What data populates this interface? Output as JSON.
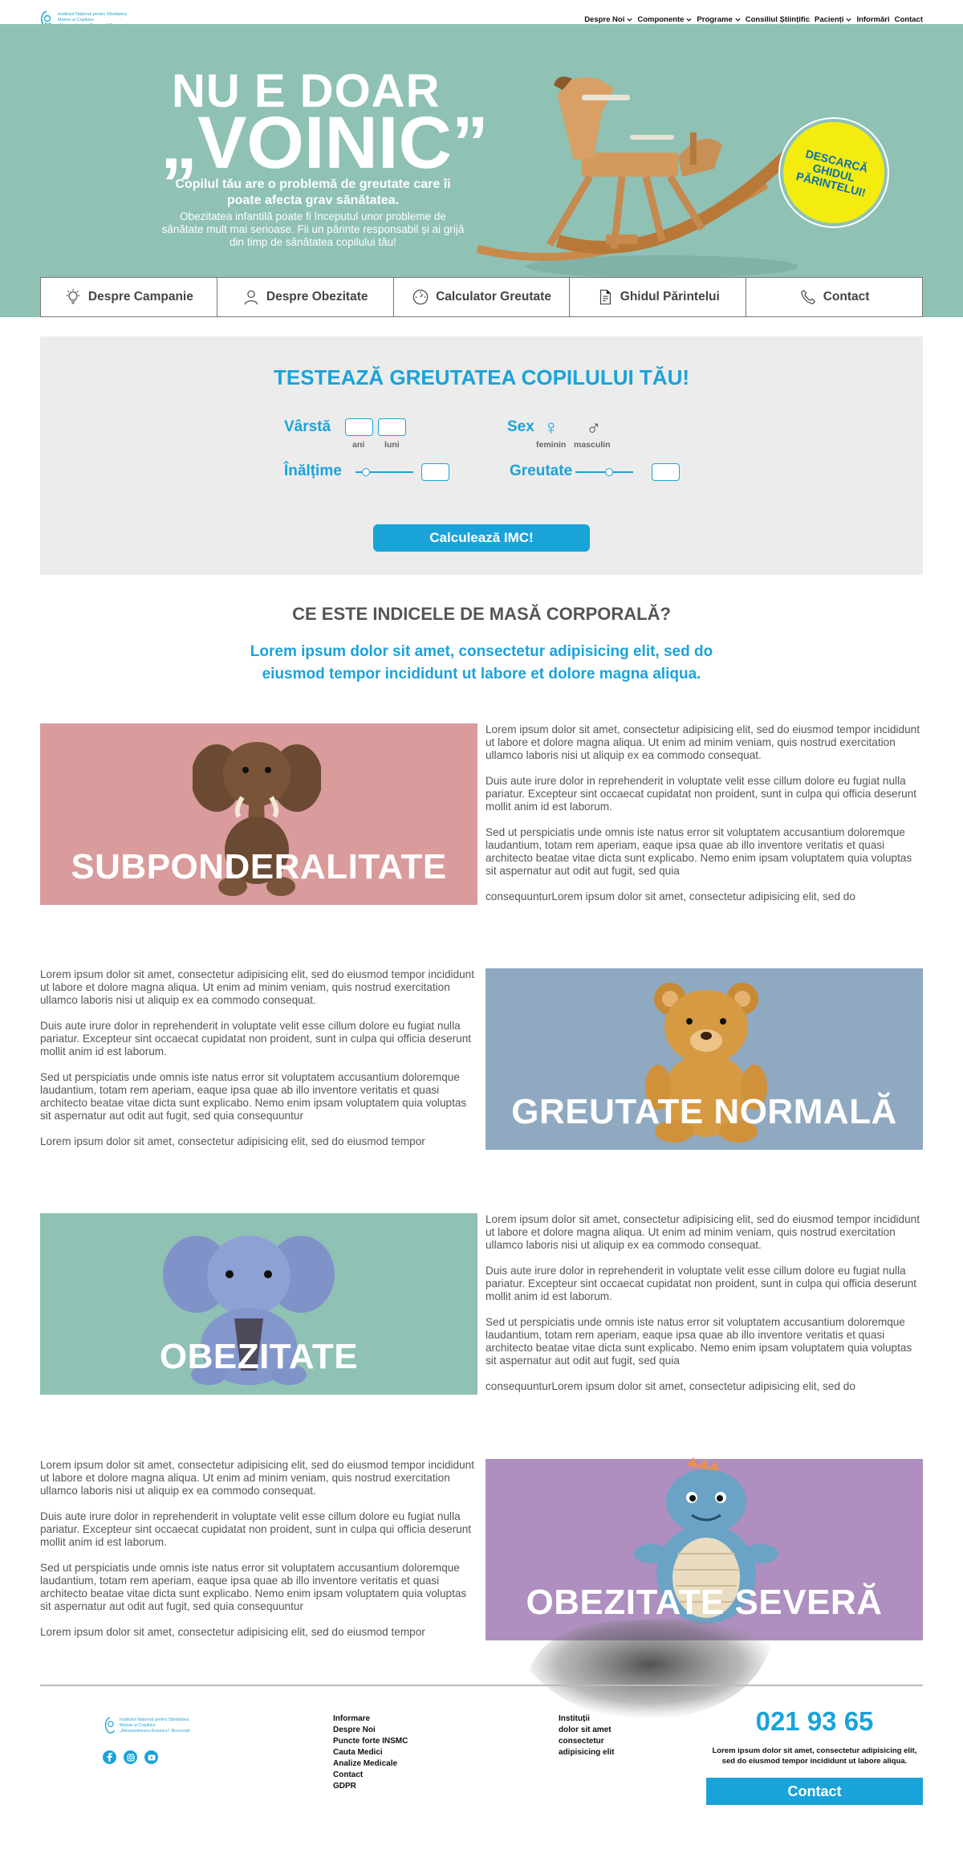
{
  "logo": {
    "lines": [
      "Institutul Național pentru Sănătatea",
      "Mamei și Copilului",
      "„Alessandrescu-Rusescu\" București"
    ]
  },
  "nav": {
    "items": [
      {
        "label": "Despre Noi",
        "dropdown": true
      },
      {
        "label": "Componente",
        "dropdown": true
      },
      {
        "label": "Programe",
        "dropdown": true
      },
      {
        "label": "Consiliul Științific",
        "dropdown": false
      },
      {
        "label": "Pacienți",
        "dropdown": true
      },
      {
        "label": "Informări",
        "dropdown": false
      },
      {
        "label": "Contact",
        "dropdown": false
      }
    ]
  },
  "hero": {
    "title_line1": "NU E DOAR",
    "title_line2": "„VOINIC”",
    "subtitle": "Copilul tău are o problemă de greutate care îi poate afecta grav sănătatea.",
    "description": "Obezitatea infantilă poate fi începutul unor probleme de sănătate mult mai serioase. Fii un părinte responsabil și ai grijă din timp de sănătatea copilului tău!",
    "badge_text": "DESCARCĂ GHIDUL PĂRINTELUI!",
    "background_color": "#8fc1b5",
    "badge_color": "#f4ec0e"
  },
  "tabs": [
    {
      "label": "Despre Campanie",
      "icon": "lightbulb-icon"
    },
    {
      "label": "Despre Obezitate",
      "icon": "person-icon"
    },
    {
      "label": "Calculator Greutate",
      "icon": "scale-icon"
    },
    {
      "label": "Ghidul Părintelui",
      "icon": "document-icon"
    },
    {
      "label": "Contact",
      "icon": "phone-icon"
    }
  ],
  "calculator": {
    "title": "TESTEAZĂ GREUTATEA COPILULUI TĂU!",
    "age_label": "Vârstă",
    "age_years_label": "ani",
    "age_months_label": "luni",
    "sex_label": "Sex",
    "sex_female_label": "feminin",
    "sex_male_label": "masculin",
    "female_symbol": "♀",
    "male_symbol": "♂",
    "height_label": "Înălțime",
    "weight_label": "Greutate",
    "submit_label": "Calculează IMC!",
    "accent_color": "#1aa3d9"
  },
  "imc": {
    "title": "CE ESTE INDICELE DE MASĂ CORPORALĂ?",
    "lead": "Lorem ipsum dolor sit amet, consectetur adipisicing elit, sed do eiusmod tempor incididunt ut labore et dolore magna aliqua."
  },
  "categories": [
    {
      "label": "SUBPONDERALITATE",
      "color": "#d99b9b",
      "toy": "elephant-plush-icon",
      "paragraphs": [
        "Lorem ipsum dolor sit amet, consectetur adipisicing elit, sed do eiusmod tempor incididunt ut labore et dolore magna aliqua. Ut enim ad minim veniam, quis nostrud exercitation ullamco laboris nisi ut aliquip ex ea commodo consequat.",
        "Duis aute irure dolor in reprehenderit in voluptate velit esse cillum dolore eu fugiat nulla pariatur. Excepteur sint occaecat cupidatat non proident, sunt in culpa qui officia deserunt mollit anim id est laborum.",
        "Sed ut perspiciatis unde omnis iste natus error sit voluptatem accusantium doloremque laudantium, totam rem aperiam, eaque ipsa quae ab illo inventore veritatis et quasi architecto beatae vitae dicta sunt explicabo. Nemo enim ipsam voluptatem quia voluptas sit aspernatur aut odit aut fugit, sed quia",
        "consequunturLorem ipsum dolor sit amet, consectetur adipisicing elit, sed do"
      ]
    },
    {
      "label": "GREUTATE NORMALĂ",
      "color": "#8fa9c0",
      "toy": "teddy-bear-icon",
      "paragraphs": [
        "Lorem ipsum dolor sit amet, consectetur adipisicing elit, sed do eiusmod tempor incididunt ut labore et dolore magna aliqua. Ut enim ad minim veniam, quis nostrud exercitation ullamco laboris nisi ut aliquip ex ea commodo consequat.",
        "Duis aute irure dolor in reprehenderit in voluptate velit esse cillum dolore eu fugiat nulla pariatur. Excepteur sint occaecat cupidatat non proident, sunt in culpa qui officia deserunt mollit anim id est laborum.",
        "Sed ut perspiciatis unde omnis iste natus error sit voluptatem accusantium doloremque laudantium, totam rem aperiam, eaque ipsa quae ab illo inventore veritatis et quasi architecto beatae vitae dicta sunt explicabo. Nemo enim ipsam voluptatem quia voluptas sit aspernatur aut odit aut fugit, sed quia consequuntur",
        "Lorem ipsum dolor sit amet, consectetur adipisicing elit, sed do eiusmod tempor"
      ]
    },
    {
      "label": "OBEZITATE",
      "color": "#8fc1b5",
      "toy": "knitted-elephant-icon",
      "paragraphs": [
        "Lorem ipsum dolor sit amet, consectetur adipisicing elit, sed do eiusmod tempor incididunt ut labore et dolore magna aliqua. Ut enim ad minim veniam, quis nostrud exercitation ullamco laboris nisi ut aliquip ex ea commodo consequat.",
        "Duis aute irure dolor in reprehenderit in voluptate velit esse cillum dolore eu fugiat nulla pariatur. Excepteur sint occaecat cupidatat non proident, sunt in culpa qui officia deserunt mollit anim id est laborum.",
        "Sed ut perspiciatis unde omnis iste natus error sit voluptatem accusantium doloremque laudantium, totam rem aperiam, eaque ipsa quae ab illo inventore veritatis et quasi architecto beatae vitae dicta sunt explicabo. Nemo enim ipsam voluptatem quia voluptas sit aspernatur aut odit aut fugit, sed quia",
        "consequunturLorem ipsum dolor sit amet, consectetur adipisicing elit, sed do"
      ]
    },
    {
      "label": "OBEZITATE SEVERĂ",
      "color": "#ae8fbf",
      "toy": "dinosaur-plush-icon",
      "paragraphs": [
        "Lorem ipsum dolor sit amet, consectetur adipisicing elit, sed do eiusmod tempor incididunt ut labore et dolore magna aliqua. Ut enim ad minim veniam, quis nostrud exercitation ullamco laboris nisi ut aliquip ex ea commodo consequat.",
        "Duis aute irure dolor in reprehenderit in voluptate velit esse cillum dolore eu fugiat nulla pariatur. Excepteur sint occaecat cupidatat non proident, sunt in culpa qui officia deserunt mollit anim id est laborum.",
        "Sed ut perspiciatis unde omnis iste natus error sit voluptatem accusantium doloremque laudantium, totam rem aperiam, eaque ipsa quae ab illo inventore veritatis et quasi architecto beatae vitae dicta sunt explicabo. Nemo enim ipsam voluptatem quia voluptas sit aspernatur aut odit aut fugit, sed quia consequuntur",
        "Lorem ipsum dolor sit amet, consectetur adipisicing elit, sed do eiusmod tempor"
      ]
    }
  ],
  "footer": {
    "links": [
      "Informare",
      "Despre Noi",
      "Puncte forte INSMC",
      "Cauta Medici",
      "Analize Medicale",
      "Contact",
      "GDPR"
    ],
    "institutions": [
      "Instituții",
      "dolor sit amet",
      "consectetur",
      "adipisicing elit"
    ],
    "phone": "021 93 65",
    "phone_text": "Lorem ipsum dolor sit amet, consectetur adipisicing elit, sed do eiusmod tempor incididunt ut labore aliqua.",
    "contact_label": "Contact",
    "social": [
      "facebook-icon",
      "instagram-icon",
      "youtube-icon"
    ]
  }
}
